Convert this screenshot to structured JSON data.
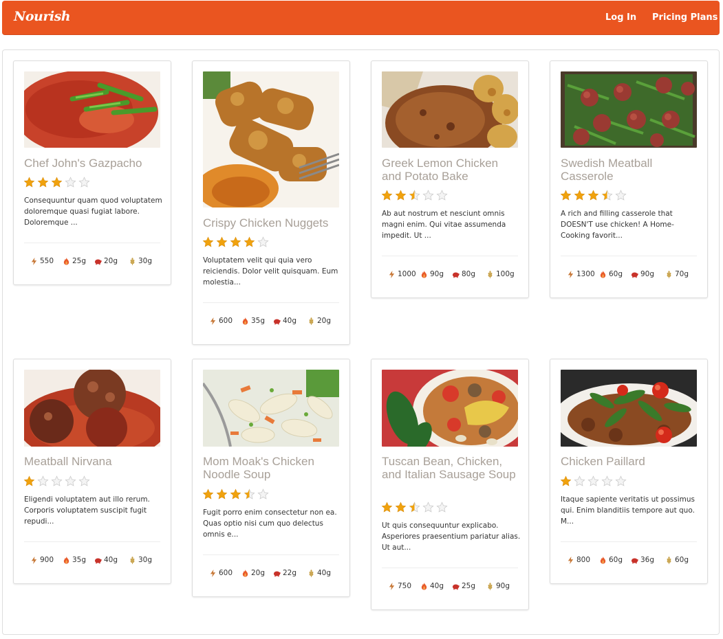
{
  "navbar": {
    "brand": "Nourish",
    "login": "Log In",
    "pricing": "Pricing Plans"
  },
  "colors": {
    "accent": "#ea5520",
    "star_on": "#f0a20e",
    "star_off": "#d8d8d8"
  },
  "recipes": [
    {
      "title": "Chef John's Gazpacho",
      "rating": 3,
      "description": "Consequuntur quam quod voluptatem doloremque quasi fugiat labore. Doloremque ...",
      "calories": "550",
      "fat": "25g",
      "protein": "20g",
      "carbs": "30g",
      "image": "gazpacho-photo"
    },
    {
      "title": "Crispy Chicken Nuggets",
      "rating": 4,
      "description": "Voluptatem velit qui quia vero reiciendis. Dolor velit quisquam. Eum molestia...",
      "calories": "600",
      "fat": "35g",
      "protein": "40g",
      "carbs": "20g",
      "image": "chicken-nuggets-photo"
    },
    {
      "title": "Greek Lemon Chicken and Potato Bake",
      "rating": 2.5,
      "description": "Ab aut nostrum et nesciunt omnis magni enim. Qui vitae assumenda impedit. Ut ...",
      "calories": "1000",
      "fat": "90g",
      "protein": "80g",
      "carbs": "100g",
      "image": "lemon-chicken-photo"
    },
    {
      "title": "Swedish Meatball Casserole",
      "rating": 3.5,
      "description": "A rich and filling casserole that DOESN'T use chicken! A Home-Cooking favorit...",
      "calories": "1300",
      "fat": "60g",
      "protein": "90g",
      "carbs": "70g",
      "image": "meatball-casserole-photo"
    },
    {
      "title": "Meatball Nirvana",
      "rating": 1,
      "description": "Eligendi voluptatem aut illo rerum. Corporis voluptatem suscipit fugit repudi...",
      "calories": "900",
      "fat": "35g",
      "protein": "40g",
      "carbs": "30g",
      "image": "meatball-photo"
    },
    {
      "title": "Mom Moak's Chicken Noodle Soup",
      "rating": 3.5,
      "description": "Fugit porro enim consectetur non ea. Quas optio nisi cum quo delectus omnis e...",
      "calories": "600",
      "fat": "20g",
      "protein": "22g",
      "carbs": "40g",
      "image": "noodle-soup-photo"
    },
    {
      "title": "Tuscan Bean, Chicken, and Italian Sausage Soup",
      "rating": 2.5,
      "description": "Ut quis consequuntur explicabo. Asperiores praesentium pariatur alias. Ut aut...",
      "calories": "750",
      "fat": "40g",
      "protein": "25g",
      "carbs": "90g",
      "image": "tuscan-soup-photo"
    },
    {
      "title": "Chicken Paillard",
      "rating": 1,
      "description": "Itaque sapiente veritatis ut possimus qui. Enim blanditiis tempore aut quo. M...",
      "calories": "800",
      "fat": "60g",
      "protein": "36g",
      "carbs": "60g",
      "image": "chicken-paillard-photo"
    }
  ]
}
